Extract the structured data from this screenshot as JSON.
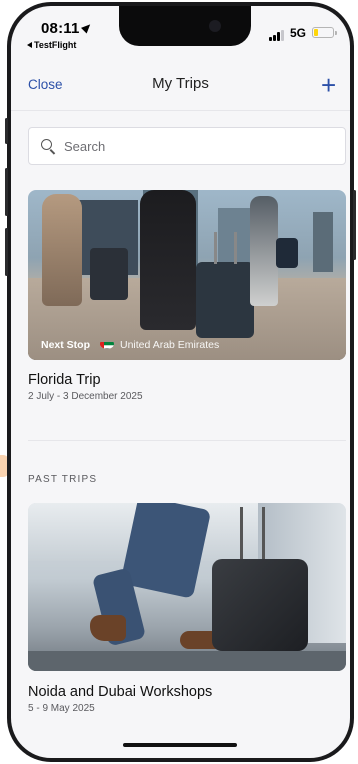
{
  "status_bar": {
    "time": "08:11",
    "back_app": "TestFlight",
    "network": "5G",
    "battery_level": 0.25
  },
  "nav": {
    "left_label": "Close",
    "title": "My Trips",
    "right_icon": "plus-icon"
  },
  "search": {
    "placeholder": "Search",
    "icon": "search-icon"
  },
  "upcoming_trip": {
    "next_stop_label": "Next Stop",
    "destination_flag": "uae-flag-icon",
    "destination": "United Arab Emirates",
    "title": "Florida Trip",
    "dates": "2 July - 3 December 2025"
  },
  "past_trips": {
    "section_label": "PAST TRIPS",
    "items": [
      {
        "title": "Noida and Dubai Workshops",
        "dates": "5 - 9 May 2025"
      }
    ]
  },
  "colors": {
    "accent": "#2c50a8",
    "battery": "#ffd60a",
    "background": "#f6f6f8"
  }
}
